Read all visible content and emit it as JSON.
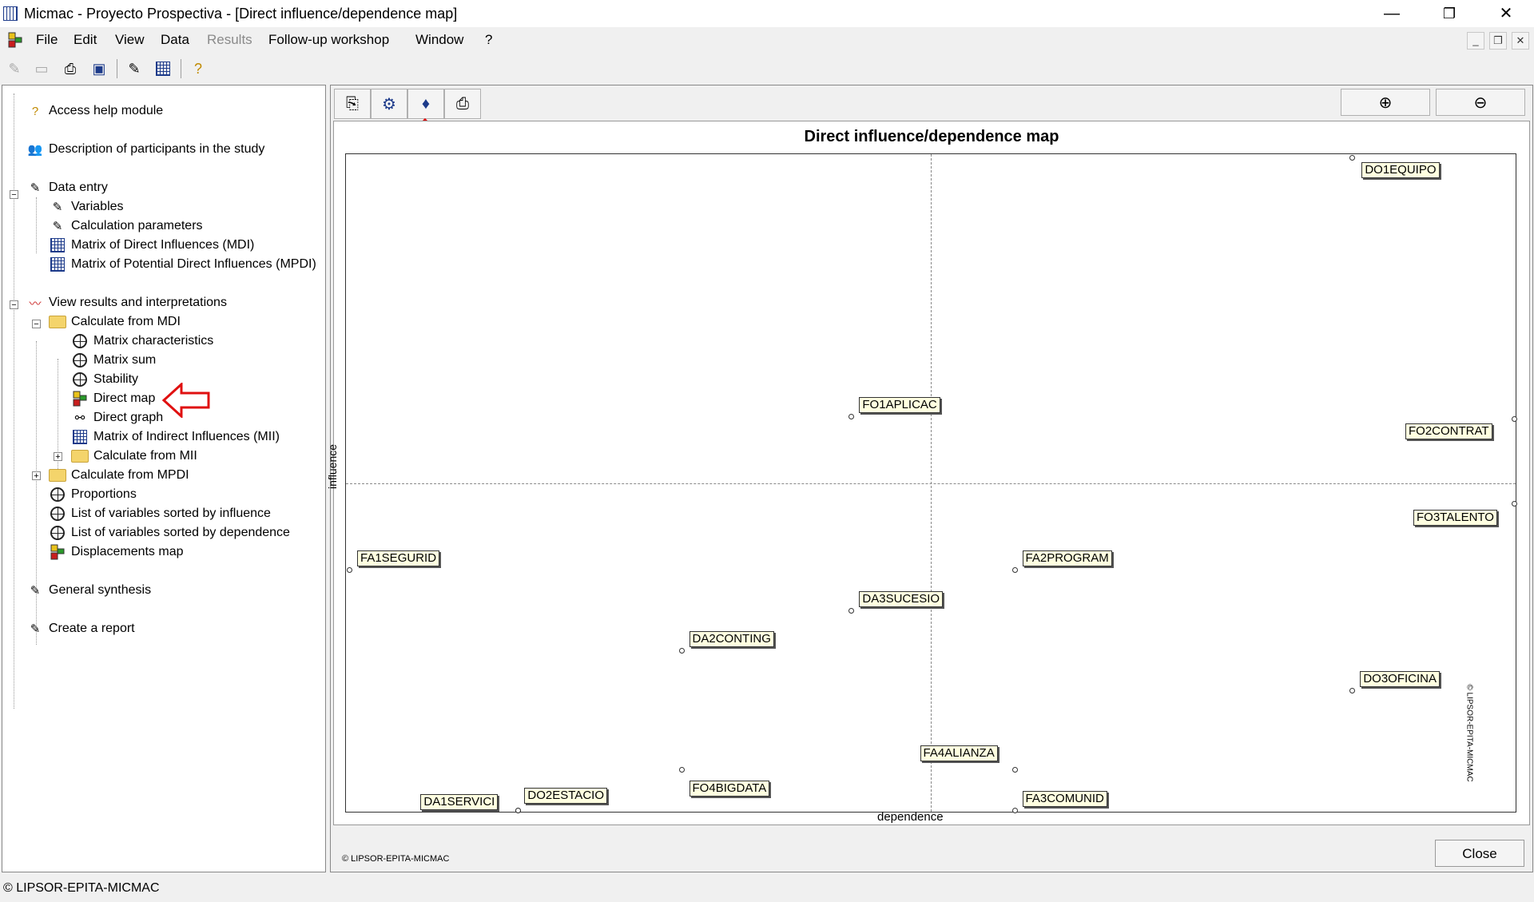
{
  "window": {
    "title": "Micmac  -  Proyecto Prospectiva - [Direct influence/dependence map]",
    "minimize": "—",
    "maximize": "❐",
    "close": "✕"
  },
  "menu": {
    "items": [
      "File",
      "Edit",
      "View",
      "Data",
      "Results",
      "Follow-up workshop",
      "Window",
      "?"
    ],
    "disabled": "Results"
  },
  "tree": {
    "help": "Access help module",
    "participants": "Description of participants in the study",
    "data_entry": "Data entry",
    "variables": "Variables",
    "calc_params": "Calculation parameters",
    "mdi": "Matrix of Direct Influences (MDI)",
    "mpdi": "Matrix of Potential Direct Influences (MPDI)",
    "view_results": "View results and interpretations",
    "calc_mdi": "Calculate from MDI",
    "matrix_char": "Matrix characteristics",
    "matrix_sum": "Matrix sum",
    "stability": "Stability",
    "direct_map": "Direct map",
    "direct_graph": "Direct graph",
    "mii": "Matrix of Indirect Influences (MII)",
    "calc_mii": "Calculate from MII",
    "calc_mpdi": "Calculate from MPDI",
    "proportions": "Proportions",
    "sorted_influence": "List of variables sorted by influence",
    "sorted_dependence": "List of variables sorted by dependence",
    "displacements": "Displacements map",
    "synthesis": "General synthesis",
    "report": "Create a report"
  },
  "map": {
    "title": "Direct influence/dependence map",
    "xlabel": "dependence",
    "ylabel": "influence",
    "copyright_side": "© LIPSOR-EPITA-MICMAC",
    "copyright_bottom": "© LIPSOR-EPITA-MICMAC"
  },
  "chart_data": {
    "type": "scatter",
    "title": "Direct influence/dependence map",
    "xlabel": "dependence",
    "ylabel": "influence",
    "grid": false,
    "points": [
      {
        "name": "DO1EQUIPO",
        "x": 0.861,
        "y": 1.0
      },
      {
        "name": "FO1APLICAC",
        "x": 0.431,
        "y": 0.604
      },
      {
        "name": "FO2CONTRAT",
        "x": 1.0,
        "y": 0.6
      },
      {
        "name": "FO3TALENTO",
        "x": 1.0,
        "y": 0.47
      },
      {
        "name": "FA1SEGURID",
        "x": 0.0,
        "y": 0.369
      },
      {
        "name": "FA2PROGRAM",
        "x": 0.571,
        "y": 0.369
      },
      {
        "name": "DA3SUCESIO",
        "x": 0.431,
        "y": 0.306
      },
      {
        "name": "DA2CONTING",
        "x": 0.285,
        "y": 0.245
      },
      {
        "name": "DO3OFICINA",
        "x": 0.861,
        "y": 0.184
      },
      {
        "name": "FA4ALIANZA",
        "x": 0.571,
        "y": 0.063
      },
      {
        "name": "FO4BIGDATA",
        "x": 0.285,
        "y": 0.063
      },
      {
        "name": "FA3COMUNID",
        "x": 0.571,
        "y": 0.0
      },
      {
        "name": "DO2ESTACIO",
        "x": 0.145,
        "y": 0.0
      },
      {
        "name": "DA1SERVICI",
        "x": 0.145,
        "y": 0.0
      }
    ]
  },
  "buttons": {
    "close": "Close"
  },
  "statusbar": "© LIPSOR-EPITA-MICMAC"
}
